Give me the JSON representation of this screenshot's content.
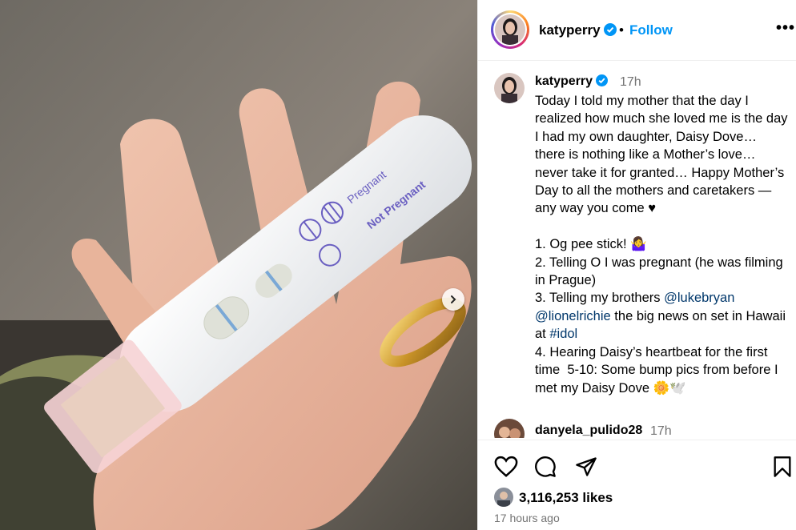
{
  "post": {
    "author": "katyperry",
    "follow_label": "Follow",
    "separator": "•",
    "more_label": "•••"
  },
  "caption": {
    "author": "katyperry",
    "time": "17h",
    "line1": "Today I told my mother that the day I realized how much she loved me is the day I had my own daughter, Daisy Dove… there is nothing like a Mother’s love… never take it for granted… Happy Mother’s Day to all the mothers and caretakers — any way you come ♥",
    "item1": "1. Og pee stick! 🤷‍♀️",
    "item2": "2. Telling O I was pregnant (he was filming in Prague)",
    "item3_pre": "3. Telling my brothers ",
    "item3_link1": "@lukebryan",
    "item3_link2": "@lionelrichie",
    "item3_mid": " the big news on set in Hawaii at ",
    "item3_link3": "#idol",
    "item4": "4. Hearing Daisy’s heartbeat for the first time  5-10: Some bump pics from before I met my Daisy Dove 🌼🕊️"
  },
  "comment": {
    "author": "danyela_pulido28",
    "time": "17h"
  },
  "footer": {
    "likes": "3,116,253 likes",
    "time_ago": "17 hours ago"
  },
  "photo": {
    "test_label_1": "Pregnant",
    "test_label_2": "Not Pregnant"
  },
  "colors": {
    "accent": "#0095f6",
    "verified": "#0095f6",
    "link": "#00376b",
    "muted": "#737373"
  },
  "icons": [
    "verified-icon",
    "chevron-right-icon",
    "heart-icon",
    "comment-icon",
    "share-icon",
    "bookmark-icon",
    "more-icon"
  ]
}
